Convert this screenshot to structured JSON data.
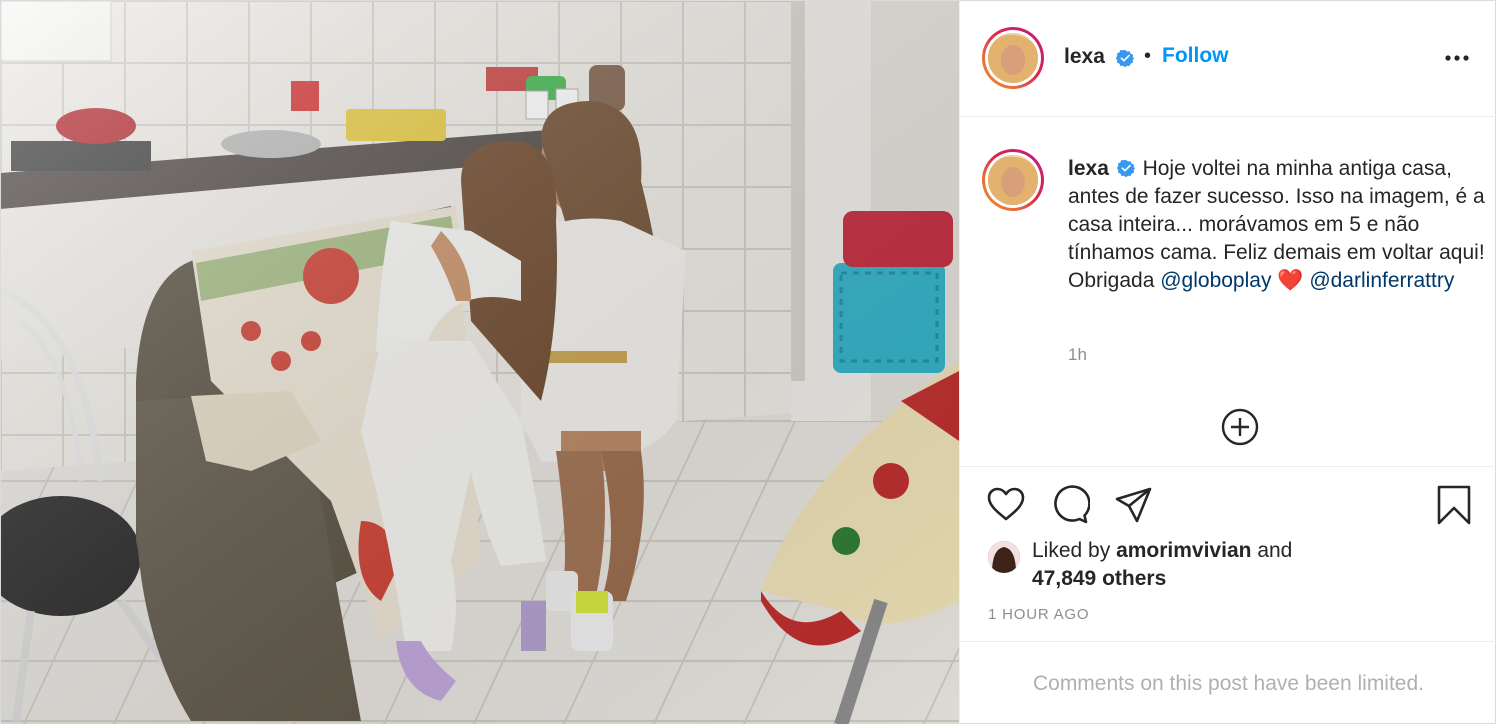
{
  "post": {
    "photo_alt": "Two women hugging on a sofa in a small kitchen",
    "author": {
      "username": "lexa",
      "verified": true,
      "follow_label": "Follow",
      "separator": "•"
    },
    "caption": {
      "username": "lexa",
      "text": "Hoje voltei na minha antiga casa, antes de fazer sucesso. Isso na imagem, é a casa inteira... morávamos em 5 e não tínhamos cama. Feliz demais em voltar aqui! Obrigada",
      "mention1": "@globoplay",
      "heart": "❤️",
      "mention2": "@darlinferrattry",
      "time": "1h"
    },
    "likes": {
      "liked_by_prefix": "Liked by",
      "liked_by_user": "amorimvivian",
      "and": "and",
      "others": "47,849 others"
    },
    "posted_ago": "1 HOUR AGO",
    "comments_notice": "Comments on this post have been limited.",
    "colors": {
      "accent": "#0095f6",
      "text": "#262626",
      "muted": "#8e8e8e",
      "verified": "#3897f0",
      "heart": "#ed4956"
    },
    "icons": [
      "verified-icon",
      "more-options-icon",
      "add-circle-icon",
      "like-heart-icon",
      "comment-icon",
      "share-icon",
      "bookmark-icon"
    ]
  }
}
